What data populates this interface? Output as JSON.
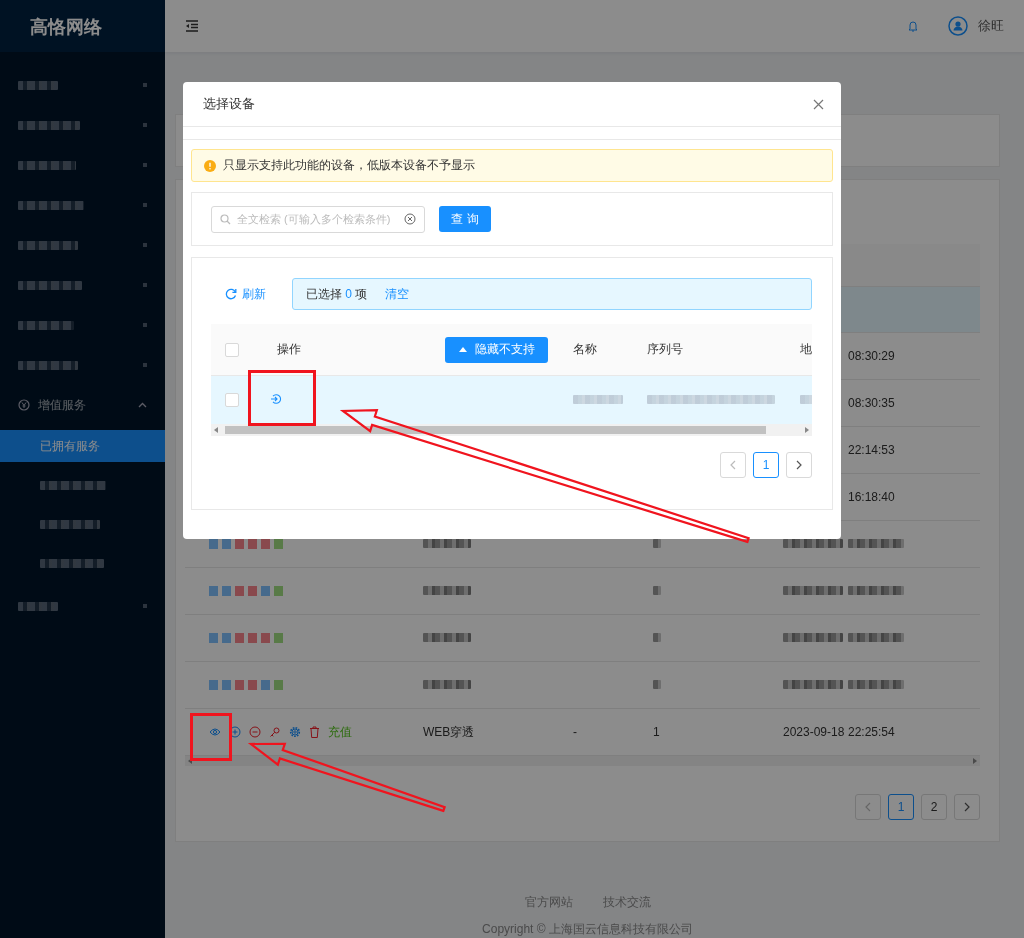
{
  "sidebar": {
    "logo": "高恪网络",
    "items": [
      {
        "kind": "blurred",
        "selected": false
      },
      {
        "kind": "blurred",
        "selected": false
      },
      {
        "kind": "blurred",
        "selected": false
      },
      {
        "kind": "blurred",
        "selected": false
      },
      {
        "kind": "blurred",
        "selected": false
      },
      {
        "kind": "blurred",
        "selected": false
      },
      {
        "kind": "blurred",
        "selected": false
      },
      {
        "kind": "blurred",
        "selected": false
      },
      {
        "kind": "group",
        "label": "增值服务",
        "selected": false,
        "expanded": true,
        "children": [
          {
            "kind": "link",
            "label": "已拥有服务",
            "selected": true
          },
          {
            "kind": "blurred",
            "selected": false
          },
          {
            "kind": "blurred",
            "selected": false
          },
          {
            "kind": "blurred",
            "selected": false
          }
        ]
      },
      {
        "kind": "blurred",
        "selected": false
      }
    ]
  },
  "header": {
    "user": "徐旺"
  },
  "table": {
    "rows": [
      {
        "kind": "header"
      },
      {
        "kind": "highlighted"
      },
      {
        "kind": "partial",
        "time": "08:30:29"
      },
      {
        "kind": "partial",
        "time": "08:30:35"
      },
      {
        "kind": "partial",
        "time": "22:14:53"
      },
      {
        "kind": "partial",
        "time": "16:18:40"
      },
      {
        "kind": "blurred"
      },
      {
        "kind": "blurred"
      },
      {
        "kind": "blurred"
      },
      {
        "kind": "blurred"
      },
      {
        "kind": "full",
        "recharge": "充值",
        "service": "WEB穿透",
        "name": "-",
        "count": "1",
        "date": "2023-09-18",
        "time": "22:25:54"
      }
    ],
    "pagination": [
      {
        "label": "1",
        "selected": true
      },
      {
        "label": "2",
        "selected": false
      }
    ]
  },
  "modal": {
    "title": "选择设备",
    "alert": "只显示支持此功能的设备，低版本设备不予显示",
    "search": {
      "placeholder": "全文检索 (可输入多个检索条件)"
    },
    "query_button": "查 询",
    "refresh": "刷新",
    "selection": {
      "prefix": "已选择",
      "count": "0",
      "suffix": "项",
      "clear": "清空"
    },
    "columns": [
      {
        "label": "操作"
      },
      {
        "label": "名称"
      },
      {
        "label": "序列号"
      },
      {
        "label": "地"
      }
    ],
    "toggle_button": "隐藏不支持",
    "select_all": {
      "checked": false
    },
    "rows": [
      {
        "checked": false,
        "highlighted": true
      }
    ],
    "pagination": [
      {
        "label": "1",
        "selected": true
      }
    ]
  },
  "footer": {
    "links": [
      "官方网站",
      "技术交流"
    ],
    "copyright": "Copyright © 上海国云信息科技有限公司"
  }
}
